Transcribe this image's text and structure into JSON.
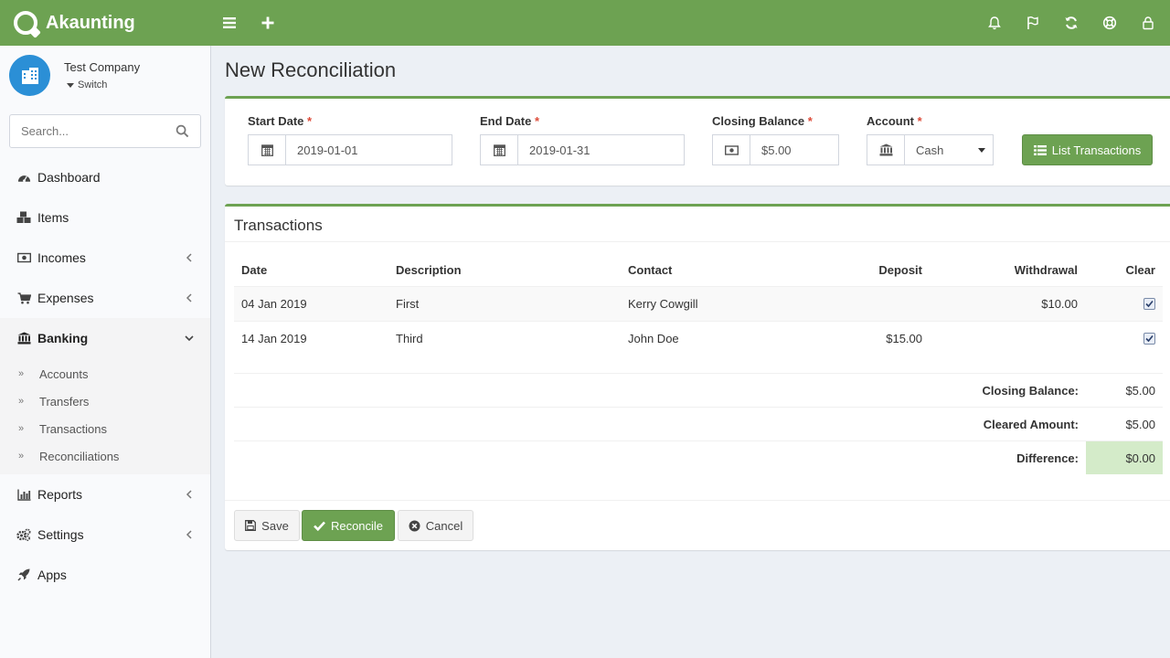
{
  "app": {
    "name": "Akaunting"
  },
  "company": {
    "name": "Test Company",
    "switch_label": "Switch"
  },
  "search": {
    "placeholder": "Search..."
  },
  "nav": {
    "dashboard": "Dashboard",
    "items": "Items",
    "incomes": "Incomes",
    "expenses": "Expenses",
    "banking": "Banking",
    "banking_sub": [
      "Accounts",
      "Transfers",
      "Transactions",
      "Reconciliations"
    ],
    "reports": "Reports",
    "settings": "Settings",
    "apps": "Apps"
  },
  "page": {
    "title": "New Reconciliation"
  },
  "form": {
    "start_date_label": "Start Date",
    "start_date": "2019-01-01",
    "end_date_label": "End Date",
    "end_date": "2019-01-31",
    "closing_balance_label": "Closing Balance",
    "closing_balance": "$5.00",
    "account_label": "Account",
    "account": "Cash",
    "required_mark": "*",
    "list_button": "List Transactions"
  },
  "transactions": {
    "title": "Transactions",
    "headers": {
      "date": "Date",
      "description": "Description",
      "contact": "Contact",
      "deposit": "Deposit",
      "withdrawal": "Withdrawal",
      "clear": "Clear"
    },
    "rows": [
      {
        "date": "04 Jan 2019",
        "description": "First",
        "contact": "Kerry Cowgill",
        "deposit": "",
        "withdrawal": "$10.00",
        "cleared": true
      },
      {
        "date": "14 Jan 2019",
        "description": "Third",
        "contact": "John Doe",
        "deposit": "$15.00",
        "withdrawal": "",
        "cleared": true
      }
    ],
    "summary": {
      "closing_balance_label": "Closing Balance:",
      "closing_balance": "$5.00",
      "cleared_amount_label": "Cleared Amount:",
      "cleared_amount": "$5.00",
      "difference_label": "Difference:",
      "difference": "$0.00"
    }
  },
  "actions": {
    "save": "Save",
    "reconcile": "Reconcile",
    "cancel": "Cancel"
  },
  "colors": {
    "brand": "#6da252",
    "difference_bg": "#d4ebc9",
    "required": "#dd4b39"
  }
}
